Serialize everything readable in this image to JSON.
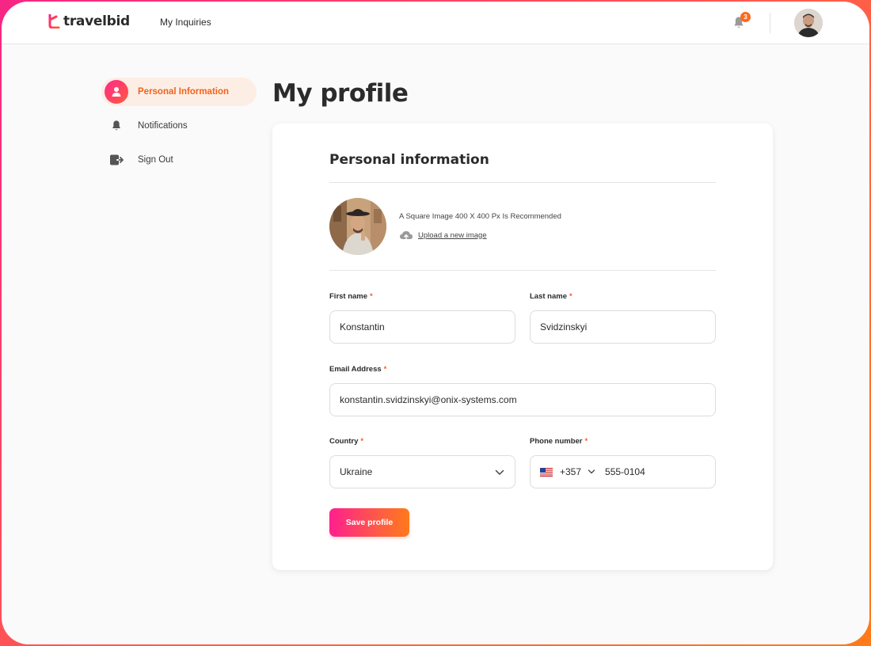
{
  "header": {
    "logo_text": "travelbid",
    "nav_inquiries": "My Inquiries",
    "notification_count": "3"
  },
  "sidebar": {
    "items": [
      {
        "label": "Personal Information",
        "icon": "user-icon",
        "active": true
      },
      {
        "label": "Notifications",
        "icon": "bell-icon",
        "active": false
      },
      {
        "label": "Sign Out",
        "icon": "sign-out-icon",
        "active": false
      }
    ]
  },
  "page": {
    "title": "My profile"
  },
  "form": {
    "section_title": "Personal information",
    "image_hint": "A Square Image 400 X 400 Px Is Recommended",
    "upload_label": "Upload a new image",
    "first_name_label": "First name",
    "first_name_value": "Konstantin",
    "last_name_label": "Last name",
    "last_name_value": "Svidzinskyi",
    "email_label": "Email Address",
    "email_value": "konstantin.svidzinskyi@onix-systems.com",
    "country_label": "Country",
    "country_value": "Ukraine",
    "phone_label": "Phone number",
    "phone_dial_code": "+357",
    "phone_value": "555-0104",
    "required_marker": "*",
    "save_label": "Save profile"
  },
  "colors": {
    "accent_orange": "#f0641e",
    "accent_pink": "#ff1f8e",
    "badge": "#ff6a1f"
  }
}
